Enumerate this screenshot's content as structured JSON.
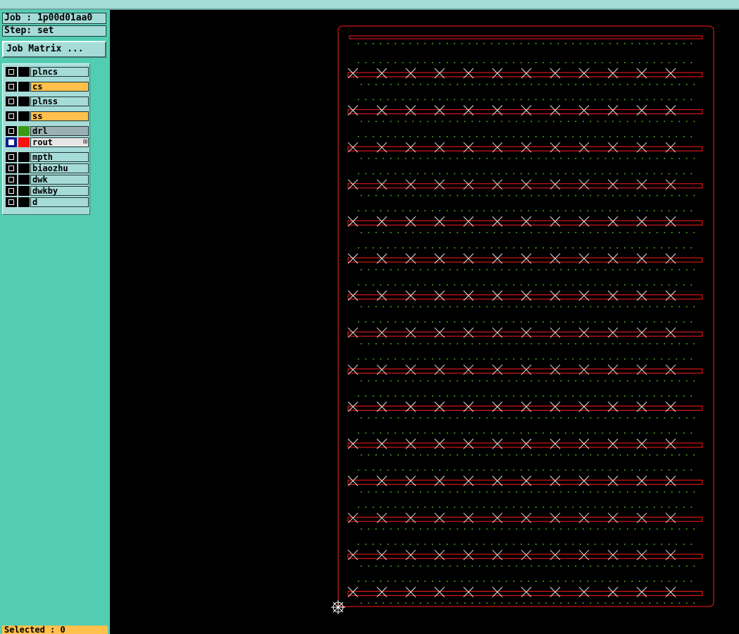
{
  "job": {
    "label": "Job : 1p00d01aa0"
  },
  "step": {
    "label": "Step: set"
  },
  "job_matrix_button": "Job Matrix ...",
  "layers": [
    {
      "name": "plncs",
      "bg": "#a6dcd8",
      "swatch": "#000000",
      "selected": false
    },
    {
      "name": "cs",
      "bg": "#ffc04c",
      "swatch": "#000000",
      "selected": false
    },
    {
      "name": "plnss",
      "bg": "#a6dcd8",
      "swatch": "#000000",
      "selected": false
    },
    {
      "name": "ss",
      "bg": "#ffc04c",
      "swatch": "#000000",
      "selected": false
    },
    {
      "name": "drl",
      "bg": "#9bb0b4",
      "swatch": "#3a9a14",
      "selected": false
    },
    {
      "name": "rout",
      "bg": "#e6e6e6",
      "swatch": "#ff1010",
      "selected": true
    },
    {
      "name": "mpth",
      "bg": "#a6dcd8",
      "swatch": "#000000",
      "selected": false
    },
    {
      "name": "biaozhu",
      "bg": "#a6dcd8",
      "swatch": "#000000",
      "selected": false
    },
    {
      "name": "dwk",
      "bg": "#a6dcd8",
      "swatch": "#000000",
      "selected": false
    },
    {
      "name": "dwkby",
      "bg": "#a6dcd8",
      "swatch": "#000000",
      "selected": false
    },
    {
      "name": "d",
      "bg": "#a6dcd8",
      "swatch": "#000000",
      "selected": false
    }
  ],
  "rout_expand_icon": "plus-icon",
  "status_text": "Selected : 0",
  "colors": {
    "rout": "#ff1a1a",
    "drill": "#4fc414",
    "cross": "#e6e6e6",
    "panel": "#53cdb1",
    "active": "#ffc04c"
  }
}
